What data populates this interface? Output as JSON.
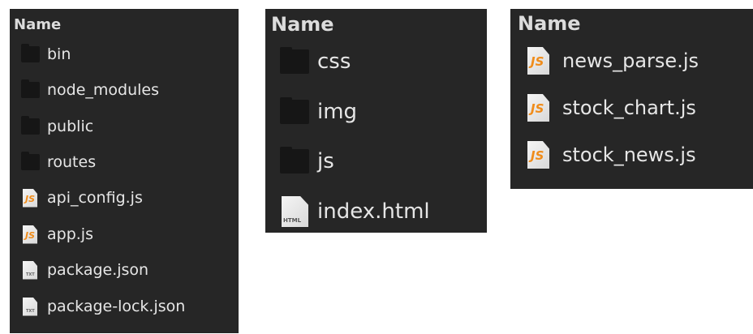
{
  "panels": [
    {
      "header": "Name",
      "items": [
        {
          "label": "bin",
          "icon": "folder-icon"
        },
        {
          "label": "node_modules",
          "icon": "folder-icon"
        },
        {
          "label": "public",
          "icon": "folder-icon"
        },
        {
          "label": "routes",
          "icon": "folder-icon"
        },
        {
          "label": "api_config.js",
          "icon": "js-file-icon",
          "badge": "JS"
        },
        {
          "label": "app.js",
          "icon": "js-file-icon",
          "badge": "JS"
        },
        {
          "label": "package.json",
          "icon": "txt-file-icon",
          "badge": "TXT"
        },
        {
          "label": "package-lock.json",
          "icon": "txt-file-icon",
          "badge": "TXT"
        }
      ]
    },
    {
      "header": "Name",
      "items": [
        {
          "label": "css",
          "icon": "folder-icon"
        },
        {
          "label": "img",
          "icon": "folder-icon"
        },
        {
          "label": "js",
          "icon": "folder-icon"
        },
        {
          "label": "index.html",
          "icon": "html-file-icon",
          "badge": "HTML"
        }
      ]
    },
    {
      "header": "Name",
      "items": [
        {
          "label": "news_parse.js",
          "icon": "js-file-icon",
          "badge": "JS"
        },
        {
          "label": "stock_chart.js",
          "icon": "js-file-icon",
          "badge": "JS"
        },
        {
          "label": "stock_news.js",
          "icon": "js-file-icon",
          "badge": "JS"
        }
      ]
    }
  ],
  "colors": {
    "panel_background": "#262626",
    "text": "#e6e6e6",
    "folder": "#161616",
    "js_badge": "#f08c1a"
  }
}
